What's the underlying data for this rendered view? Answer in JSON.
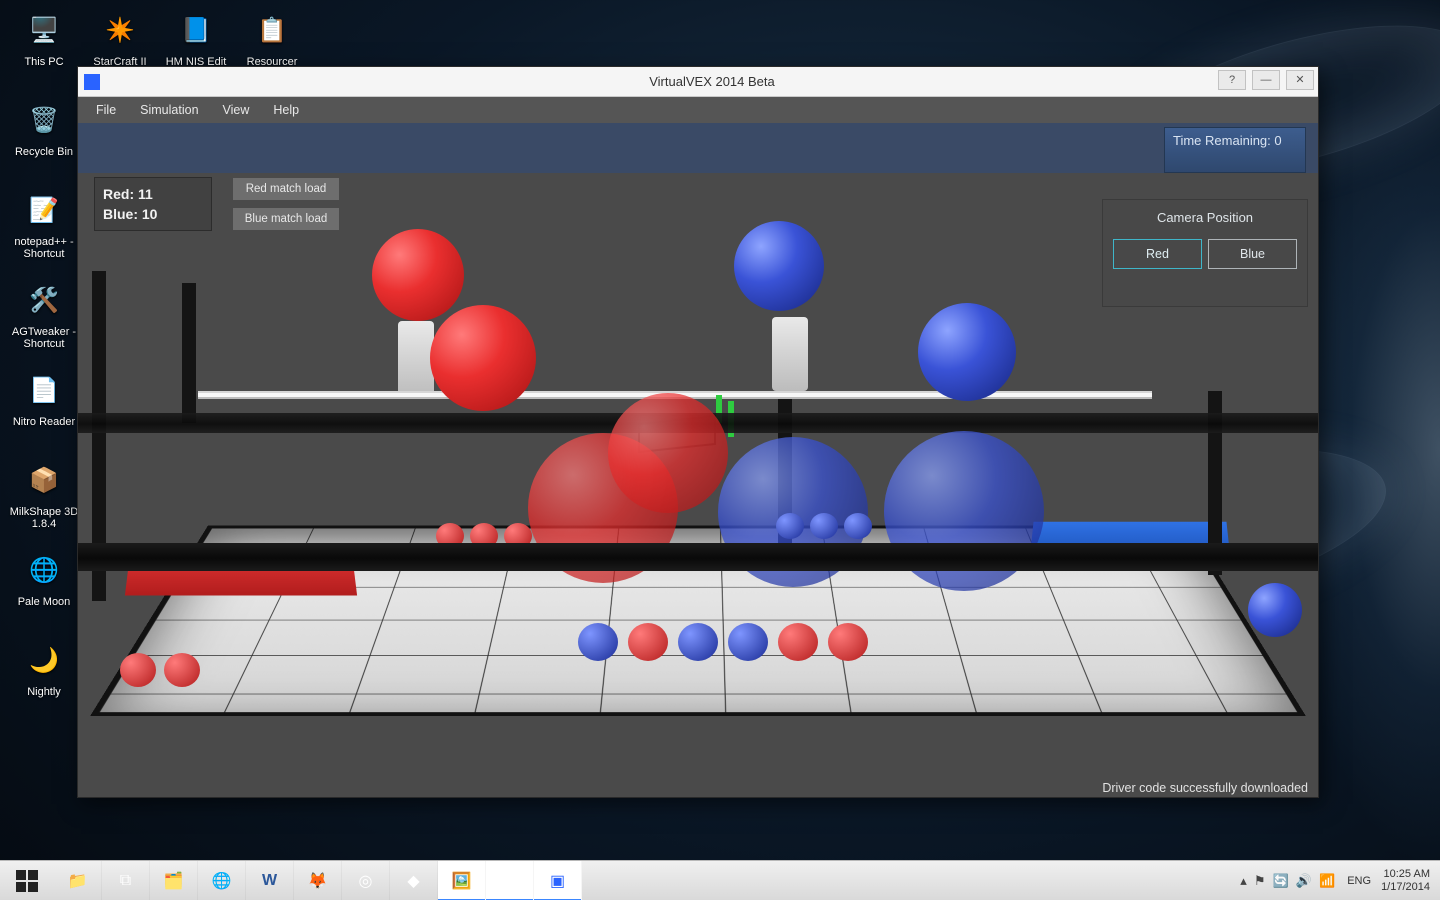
{
  "desktop": {
    "icons_col": [
      {
        "label": "This PC",
        "glyph": "🖥️"
      },
      {
        "label": "Recycle Bin",
        "glyph": "🗑️"
      },
      {
        "label": "notepad++ - Shortcut",
        "glyph": "📝"
      },
      {
        "label": "AGTweaker - Shortcut",
        "glyph": "🛠️"
      },
      {
        "label": "Nitro Reader",
        "glyph": "📄"
      },
      {
        "label": "MilkShape 3D 1.8.4",
        "glyph": "📦"
      },
      {
        "label": "Pale Moon",
        "glyph": "🌐"
      },
      {
        "label": "Nightly",
        "glyph": "🌙"
      }
    ],
    "icons_row": [
      {
        "label": "StarCraft II",
        "glyph": "✴️"
      },
      {
        "label": "HM NIS Edit",
        "glyph": "📘"
      },
      {
        "label": "Resourcer",
        "glyph": "📋"
      }
    ]
  },
  "window": {
    "title": "VirtualVEX 2014 Beta",
    "btn_help": "?",
    "btn_min": "—",
    "btn_close": "✕",
    "menu": [
      "File",
      "Simulation",
      "View",
      "Help"
    ]
  },
  "hud": {
    "time_label": "Time Remaining:",
    "time_value": "0",
    "red_label": "Red:",
    "red_score": "11",
    "blue_label": "Blue:",
    "blue_score": "10",
    "btn_red_load": "Red match load",
    "btn_blue_load": "Blue match load",
    "camera_title": "Camera Position",
    "camera_red": "Red",
    "camera_blue": "Blue",
    "status": "Driver code successfully downloaded"
  },
  "taskbar": {
    "apps": [
      {
        "name": "file-explorer",
        "glyph": "📁",
        "active": false
      },
      {
        "name": "powershell",
        "glyph": "⧉",
        "active": false
      },
      {
        "name": "folder",
        "glyph": "🗂️",
        "active": false
      },
      {
        "name": "browser",
        "glyph": "🌐",
        "active": false
      },
      {
        "name": "word",
        "glyph": "W",
        "active": false
      },
      {
        "name": "gimp",
        "glyph": "🦊",
        "active": false
      },
      {
        "name": "obs",
        "glyph": "◎",
        "active": false
      },
      {
        "name": "unity",
        "glyph": "◆",
        "active": false
      },
      {
        "name": "images",
        "glyph": "🖼️",
        "active": true
      },
      {
        "name": "nsis",
        "glyph": "⬢",
        "active": true
      },
      {
        "name": "virtualvex",
        "glyph": "▣",
        "active": true
      }
    ],
    "lang": "ENG",
    "time": "10:25 AM",
    "date": "1/17/2014"
  }
}
